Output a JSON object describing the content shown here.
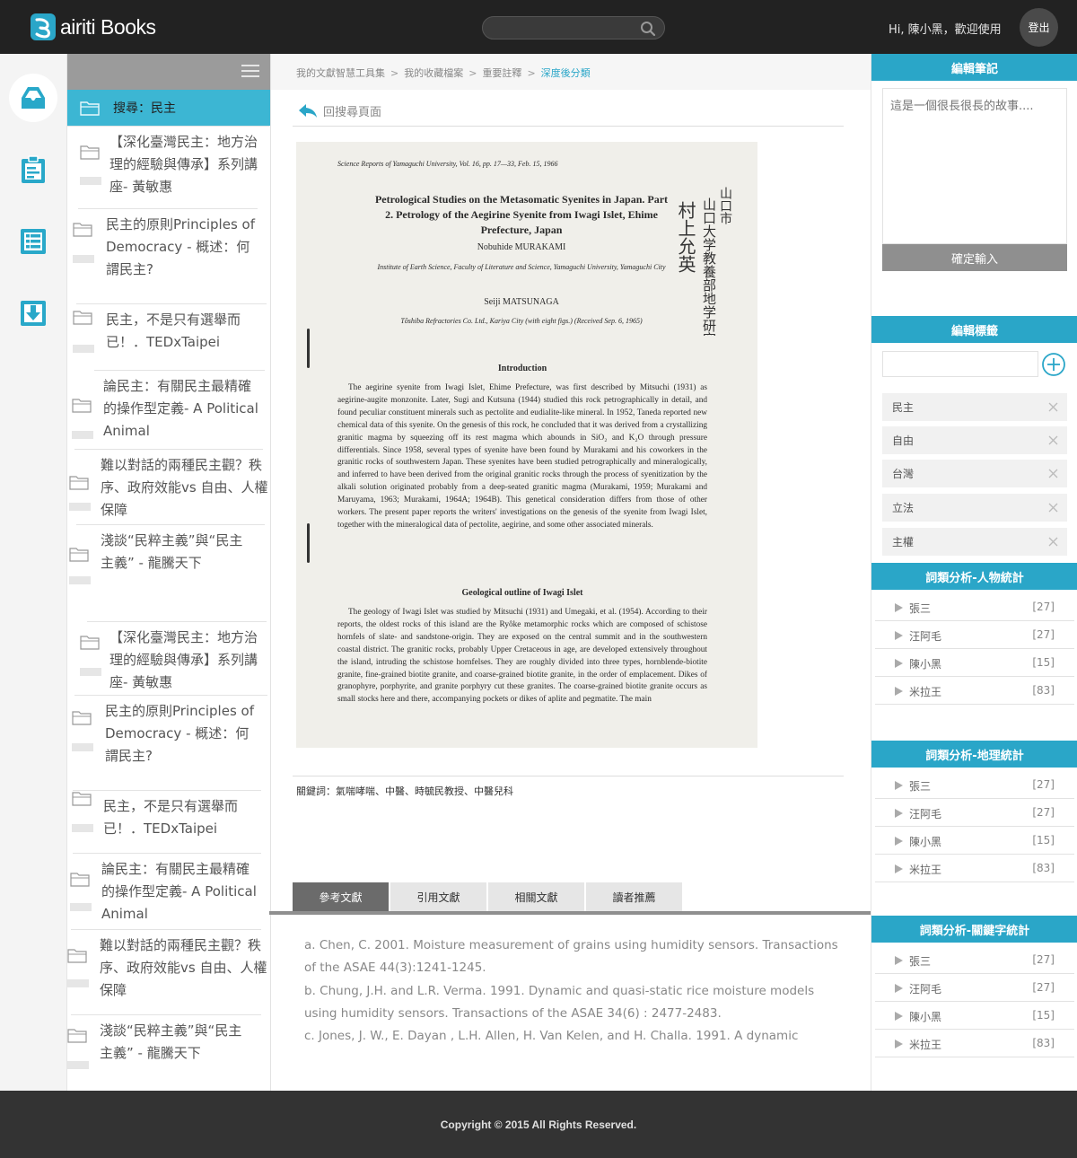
{
  "header": {
    "logo_text": "airiti Books",
    "search_placeholder": "",
    "greeting": "Hi, 陳小黑，歡迎使用",
    "logout_label": "登出"
  },
  "rail": {
    "items": [
      "inbox-icon",
      "clipboard-icon",
      "list-icon",
      "download-icon"
    ],
    "active_color": "#29a8c9"
  },
  "folders": {
    "current_label": "搜尋：民主",
    "items": [
      {
        "lines": [
          "【深化臺灣民主：地方治",
          "理的經驗與傳承】系列講",
          "座- 黃敏惠"
        ]
      },
      {
        "lines": [
          "民主的原則Principles of",
          "Democracy - 概述：何",
          "謂民主?"
        ]
      },
      {
        "lines": [
          "民主，不是只有選舉而",
          "已！．TEDxTaipei"
        ]
      },
      {
        "lines": [
          "論民主：有關民主最精確",
          "的操作型定義- A Political",
          "Animal"
        ]
      },
      {
        "lines": [
          "難以對話的兩種民主觀？秩",
          "序、政府效能vs 自由、人權",
          "保障"
        ]
      },
      {
        "lines": [
          "淺談“民粹主義”與“民主",
          "主義” - 龍騰天下"
        ]
      },
      {
        "lines": [
          "【深化臺灣民主：地方治",
          "理的經驗與傳承】系列講",
          "座- 黃敏惠"
        ]
      },
      {
        "lines": [
          "民主的原則Principles of",
          "Democracy - 概述：何",
          "謂民主?"
        ]
      },
      {
        "lines": [
          "民主，不是只有選舉而",
          "已！．TEDxTaipei"
        ]
      },
      {
        "lines": [
          "論民主：有關民主最精確",
          "的操作型定義- A Political",
          "Animal"
        ]
      },
      {
        "lines": [
          "難以對話的兩種民主觀？秩",
          "序、政府效能vs 自由、人權",
          "保障"
        ]
      },
      {
        "lines": [
          "淺談“民粹主義”與“民主",
          "主義” - 龍騰天下"
        ]
      }
    ]
  },
  "breadcrumb": {
    "items": [
      "我的文獻智慧工具集",
      "我的收藏檔案",
      "重要註釋"
    ],
    "current": "深度後分類",
    "separator": ">"
  },
  "back_label": "回搜尋頁面",
  "paper": {
    "header": "Science Reports of Yamaguchi University, Vol. 16, pp. 17—33, Feb. 15, 1966",
    "title": "Petrological Studies on the Metasomatic Syenites in Japan. Part 2.  Petrology of the Aegirine Syenite from Iwagi Islet, Ehime Prefecture, Japan",
    "author1": "Nobuhide MURAKAMI",
    "affiliation1": "Institute of Earth Science, Faculty of Literature and Science, Yamaguchi University, Yamaguchi City",
    "author2": "Seiji MATSUNAGA",
    "affiliation2": "Tôshiba Refractories Co. Ltd., Kariya City (with eight figs.) (Received Sep. 6, 1965)",
    "section1": "Introduction",
    "body1": "The aegirine syenite from Iwagi Islet, Ehime Prefecture, was first described by Mitsuchi (1931) as aegirine-augite monzonite.  Later, Sugi and Kutsuna (1944) studied this rock petrographically in detail, and found peculiar constituent minerals such as pectolite and eudialite-like mineral.  In 1952, Taneda reported new chemical data of this syenite.  On the genesis of this rock, he concluded that it was derived from a crystallizing granitic magma by squeezing off its rest magma which abounds in SiO₂ and K₂O through pressure differentials.  Since 1958, several types of syenite have been found by Murakami and his coworkers in the granitic rocks of southwestern Japan.  These syenites have been studied petrographically and mineralogically, and inferred to have been derived from the original granitic rocks through the process of syenitization by the alkali solution originated probably from a deep-seated granitic magma (Murakami, 1959; Murakami and Maruyama, 1963; Murakami, 1964A; 1964B).  This genetical consideration differs from those of other workers.  The present paper reports the writers' investigations on the genesis of the syenite from Iwagi Islet, together with the mineralogical data of pectolite, aegirine, and some other associated minerals.",
    "section2": "Geological outline of Iwagi Islet",
    "body2": "The geology of Iwagi Islet was studied by Mitsuchi (1931) and Umegaki, et al. (1954).  According to their reports, the oldest rocks of this island are the Ryôke metamorphic rocks which are composed of schistose hornfels of slate- and sandstone-origin.  They are exposed on the central summit and in the southwestern coastal district.  The granitic rocks, probably Upper Cretaceous in age, are developed extensively throughout the island, intruding the schistose hornfelses.  They are roughly divided into three types, hornblende-biotite granite, fine-grained biotite granite, and coarse-grained biotite granite, in the order of emplacement.  Dikes of granophyre, porphyrite, and granite porphyry cut these granites.  The coarse-grained biotite granite occurs as small stocks here and there, accompanying pockets or dikes of aplite and pegmatite.  The main",
    "stamp_text": "山口大學教養部地學研究室 村上允英"
  },
  "keywords": "關鍵詞：氣喘哮喘、中醫、時毓民教授、中醫兒科",
  "tabs": [
    "參考文獻",
    "引用文獻",
    "相關文獻",
    "讀者推薦"
  ],
  "active_tab": 0,
  "references": [
    "a. Chen, C. 2001. Moisture measurement of grains using humidity sensors. Transactions of the ASAE 44(3):1241-1245.",
    "b. Chung, J.H. and L.R. Verma. 1991. Dynamic and quasi-static rice moisture models using humidity sensors. Transactions of the ASAE 34(6) : 2477-2483.",
    "c. Jones, J. W., E. Dayan , L.H. Allen, H. Van Kelen, and H. Challa. 1991. A dynamic"
  ],
  "notes": {
    "title": "編輯筆記",
    "placeholder": "這是一個很長很長的故事....",
    "confirm_label": "確定輸入"
  },
  "tags": {
    "title": "編輯標籤",
    "items": [
      "民主",
      "自由",
      "台灣",
      "立法",
      "主權"
    ]
  },
  "stats": [
    {
      "title": "詞類分析-人物統計",
      "rows": [
        {
          "name": "張三",
          "count": "[27]"
        },
        {
          "name": "汪阿毛",
          "count": "[27]"
        },
        {
          "name": "陳小黑",
          "count": "[15]"
        },
        {
          "name": "米拉王",
          "count": "[83]"
        }
      ]
    },
    {
      "title": "詞類分析-地理統計",
      "rows": [
        {
          "name": "張三",
          "count": "[27]"
        },
        {
          "name": "汪阿毛",
          "count": "[27]"
        },
        {
          "name": "陳小黑",
          "count": "[15]"
        },
        {
          "name": "米拉王",
          "count": "[83]"
        }
      ]
    },
    {
      "title": "詞類分析-關鍵字統計",
      "rows": [
        {
          "name": "張三",
          "count": "[27]"
        },
        {
          "name": "汪阿毛",
          "count": "[27]"
        },
        {
          "name": "陳小黑",
          "count": "[15]"
        },
        {
          "name": "米拉王",
          "count": "[83]"
        }
      ]
    }
  ],
  "footer": "Copyright © 2015 All Rights Reserved.",
  "colors": {
    "accent": "#2aa6c8",
    "topbar": "#222222",
    "footer": "#333333"
  }
}
